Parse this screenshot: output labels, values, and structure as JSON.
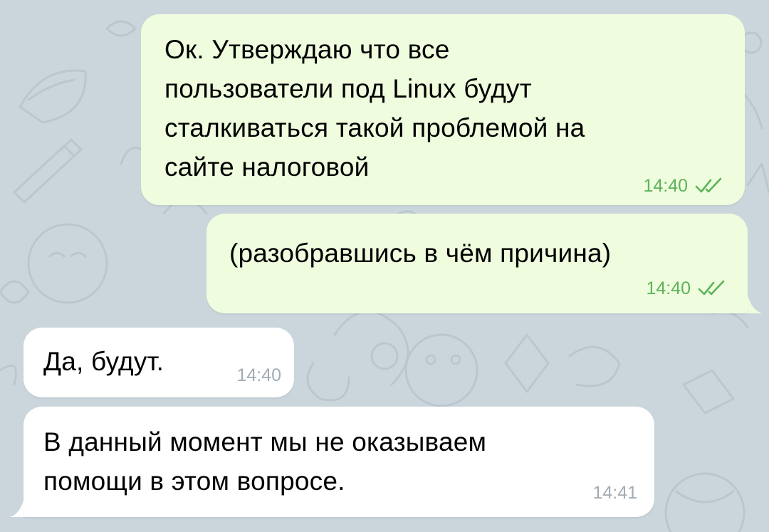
{
  "chat": {
    "messages": [
      {
        "id": "m1",
        "direction": "outgoing",
        "lines": [
          "Ок. Утверждаю что все",
          "пользователи под Linux будут",
          "сталкиваться такой проблемой на",
          "сайте налоговой"
        ],
        "time": "14:40",
        "status_icon": "double-check-icon"
      },
      {
        "id": "m2",
        "direction": "outgoing",
        "lines": [
          "(разобравшись в чём причина)"
        ],
        "time": "14:40",
        "status_icon": "double-check-icon"
      },
      {
        "id": "m3",
        "direction": "incoming",
        "lines": [
          "Да, будут."
        ],
        "time": "14:40"
      },
      {
        "id": "m4",
        "direction": "incoming",
        "lines": [
          "В данный момент мы не оказываем",
          "помощи в этом вопросе."
        ],
        "time": "14:41"
      }
    ]
  },
  "colors": {
    "background": "#cbd6dc",
    "outgoing_bubble": "#effdde",
    "incoming_bubble": "#ffffff",
    "outgoing_meta": "#5cb35a",
    "incoming_meta": "#a3acb4"
  }
}
